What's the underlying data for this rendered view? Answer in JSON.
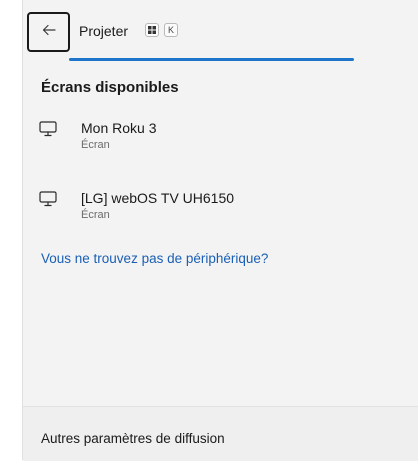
{
  "header": {
    "title": "Projeter",
    "shortcut_key": "K",
    "back_icon": "arrow-left-icon",
    "windows_key_icon": "windows-logo-icon"
  },
  "progress": {
    "indeterminate": true,
    "color": "#1c75c9"
  },
  "section": {
    "title": "Écrans disponibles"
  },
  "devices": [
    {
      "name": "Mon Roku 3",
      "type": "Écran",
      "icon": "monitor-icon"
    },
    {
      "name": "[LG] webOS TV UH6150",
      "type": "Écran",
      "icon": "monitor-icon"
    }
  ],
  "help_link": {
    "label": "Vous ne trouvez pas de périphérique?",
    "color": "#1a5fb4"
  },
  "footer": {
    "label": "Autres paramètres de diffusion"
  }
}
